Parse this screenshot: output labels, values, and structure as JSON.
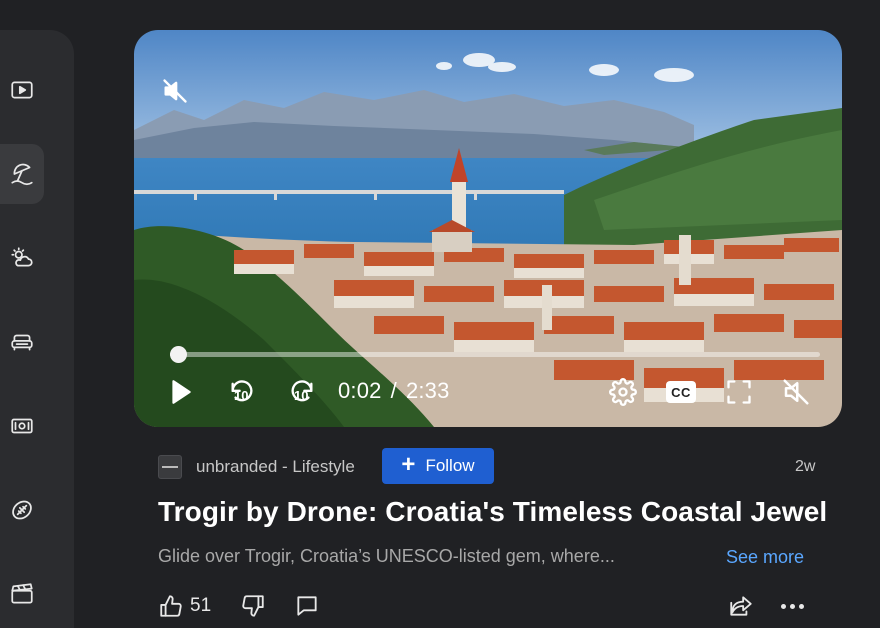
{
  "sidebar": {
    "items": [
      {
        "icon": "video-play-icon",
        "active": false
      },
      {
        "icon": "beach-umbrella-icon",
        "active": true
      },
      {
        "icon": "weather-icon",
        "active": false
      },
      {
        "icon": "sofa-icon",
        "active": false
      },
      {
        "icon": "money-icon",
        "active": false
      },
      {
        "icon": "sports-ball-icon",
        "active": false
      },
      {
        "icon": "clapperboard-icon",
        "active": false
      }
    ]
  },
  "player": {
    "current_time": "0:02",
    "separator": "/",
    "duration": "2:33",
    "progress_fraction": 0.013,
    "skip_back_label": "10",
    "skip_forward_label": "10",
    "cc_label": "CC",
    "muted": true
  },
  "post": {
    "channel": "unbranded - Lifestyle",
    "follow_label": "Follow",
    "age": "2w",
    "title": "Trogir by Drone: Croatia's Timeless Coastal Jewel",
    "description": "Glide over Trogir, Croatia’s UNESCO-listed gem, where...",
    "see_more_label": "See more",
    "like_count": "51"
  },
  "colors": {
    "background": "#202124",
    "sidebar": "#2b2c2f",
    "follow_button": "#1f5fd1",
    "link": "#5aa7ff"
  }
}
